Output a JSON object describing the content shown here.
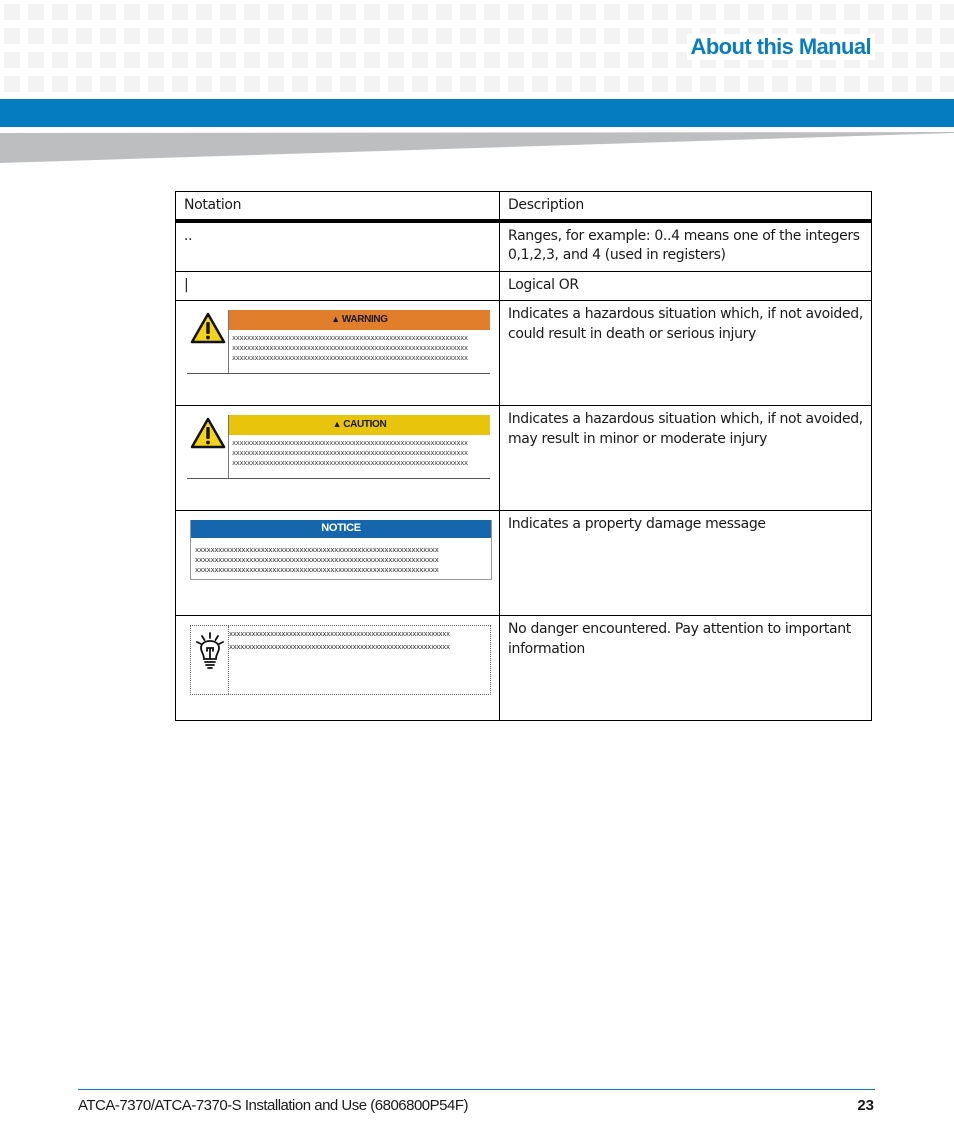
{
  "header": {
    "section_title": "About this Manual",
    "brand_color": "#047cbf",
    "title_color": "#0a7cc0"
  },
  "table": {
    "columns": [
      "Notation",
      "Description"
    ],
    "rows": [
      {
        "notation": "..",
        "description": "Ranges, for example: 0..4 means one of the integers 0,1,2,3, and 4 (used in registers)"
      },
      {
        "notation": "|",
        "description": "Logical OR"
      },
      {
        "notation_icon": "warning-sign",
        "sign_label": "WARNING",
        "sign_color": "#e07e2c",
        "placeholder_text": "xxxxxxxxxxxxxxxxxxxxxxxxxxxxxxxxxxxxxxxxxxxxxxxxxxxxxxxxxxxxxxx",
        "description": "Indicates a hazardous situation which, if not avoided, could result in death or serious injury"
      },
      {
        "notation_icon": "caution-sign",
        "sign_label": "CAUTION",
        "sign_color": "#e8c40c",
        "placeholder_text": "xxxxxxxxxxxxxxxxxxxxxxxxxxxxxxxxxxxxxxxxxxxxxxxxxxxxxxxxxxxxxxx",
        "description": "Indicates a hazardous situation which, if not avoided, may result in minor or moderate injury"
      },
      {
        "notation_icon": "notice-sign",
        "sign_label": "NOTICE",
        "sign_color": "#1566ad",
        "placeholder_text": "xxxxxxxxxxxxxxxxxxxxxxxxxxxxxxxxxxxxxxxxxxxxxxxxxxxxxxxxxxxxxxx",
        "description": "Indicates a property damage message"
      },
      {
        "notation_icon": "tip-lightbulb",
        "placeholder_text": "xxxxxxxxxxxxxxxxxxxxxxxxxxxxxxxxxxxxxxxxxxxxxxxxxxxxxxxxxxx",
        "description": "No danger encountered. Pay attention to important information"
      }
    ]
  },
  "footer": {
    "document_title": "ATCA-7370/ATCA-7370-S Installation and Use (6806800P54F)",
    "page_number": "23"
  }
}
